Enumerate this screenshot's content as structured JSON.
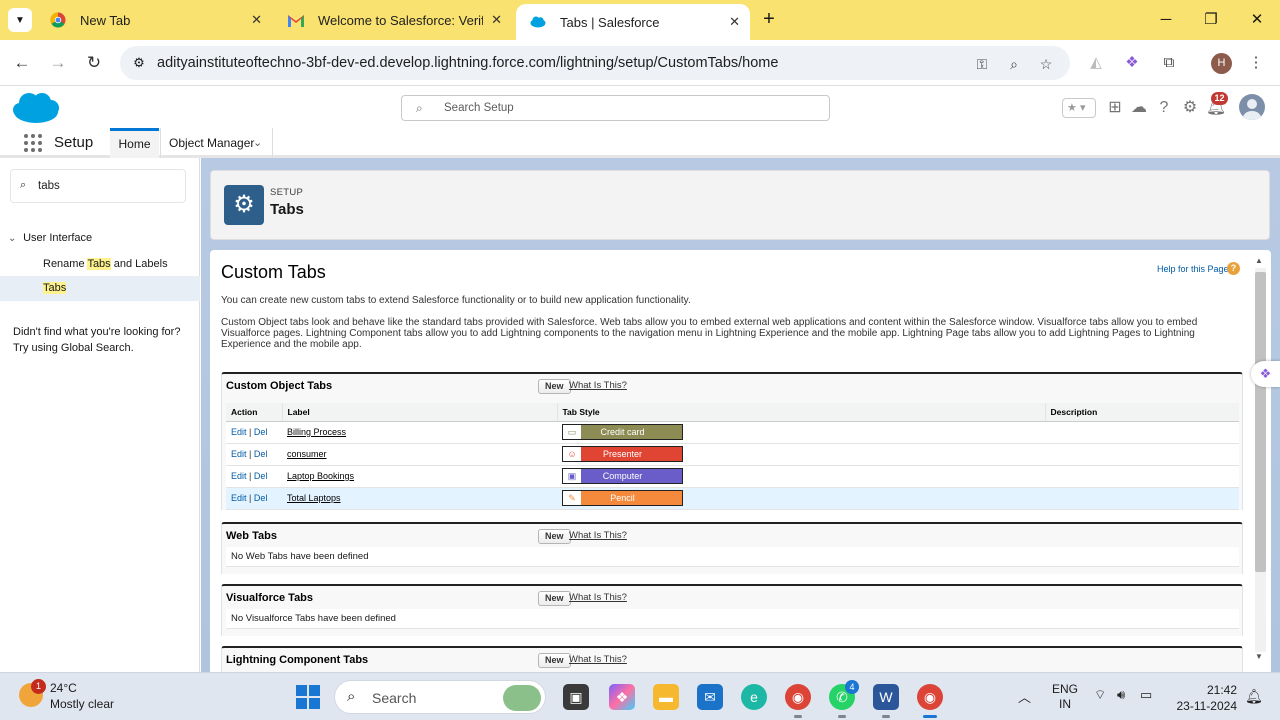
{
  "browser": {
    "tabs": [
      {
        "title": "New Tab"
      },
      {
        "title": "Welcome to Salesforce: Verify y"
      },
      {
        "title": "Tabs | Salesforce"
      }
    ],
    "url": "adityainstituteoftechno-3bf-dev-ed.develop.lightning.force.com/lightning/setup/CustomTabs/home",
    "profile_initial": "H"
  },
  "sf_header": {
    "search_placeholder": "Search Setup",
    "notification_count": "12"
  },
  "sf_nav": {
    "app_name": "Setup",
    "home_label": "Home",
    "object_manager_label": "Object Manager"
  },
  "sidebar": {
    "quick_find_value": "tabs",
    "group_label": "User Interface",
    "items": [
      {
        "pre": "Rename ",
        "hl": "Tabs",
        "post": " and Labels"
      },
      {
        "hl": "Tabs"
      }
    ],
    "help_line1": "Didn't find what you're looking for?",
    "help_line2": "Try using Global Search."
  },
  "page_header": {
    "eyebrow": "SETUP",
    "title": "Tabs"
  },
  "content": {
    "title": "Custom Tabs",
    "help_link": "Help for this Page",
    "intro1": "You can create new custom tabs to extend Salesforce functionality or to build new application functionality.",
    "intro2": "Custom Object tabs look and behave like the standard tabs provided with Salesforce. Web tabs allow you to embed external web applications and content within the Salesforce window. Visualforce tabs allow you to embed Visualforce pages. Lightning Component tabs allow you to add Lightning components to the navigation menu in Lightning Experience and the mobile app. Lightning Page tabs allow you to add Lightning Pages to Lightning Experience and the mobile app.",
    "new_label": "New",
    "what_label": "What Is This?",
    "custom_object": {
      "heading": "Custom Object Tabs",
      "columns": [
        "Action",
        "Label",
        "Tab Style",
        "Description"
      ],
      "edit": "Edit",
      "sep": "|",
      "del": "Del",
      "rows": [
        {
          "label": "Billing Process",
          "style": "Credit card",
          "color": "#8e8c55",
          "icon": "card-icon"
        },
        {
          "label": "consumer",
          "style": "Presenter",
          "color": "#e04534",
          "icon": "presenter-icon"
        },
        {
          "label": "Laptop Bookings",
          "style": "Computer",
          "color": "#6a5cc9",
          "icon": "computer-icon"
        },
        {
          "label": "Total Laptops",
          "style": "Pencil",
          "color": "#f58a3c",
          "icon": "pencil-icon"
        }
      ]
    },
    "web_tabs": {
      "heading": "Web Tabs",
      "empty": "No Web Tabs have been defined"
    },
    "vf_tabs": {
      "heading": "Visualforce Tabs",
      "empty": "No Visualforce Tabs have been defined"
    },
    "lc_tabs": {
      "heading": "Lightning Component Tabs"
    }
  },
  "taskbar": {
    "weather_badge": "1",
    "temp": "24°C",
    "condition": "Mostly clear",
    "search": "Search",
    "whatsapp_badge": "4",
    "lang1": "ENG",
    "lang2": "IN",
    "time": "21:42",
    "date": "23-11-2024"
  },
  "colors": {
    "tabbar": "#f9e26f",
    "sf_blue": "#0176d3",
    "setup_bg": "#b0c4df"
  }
}
